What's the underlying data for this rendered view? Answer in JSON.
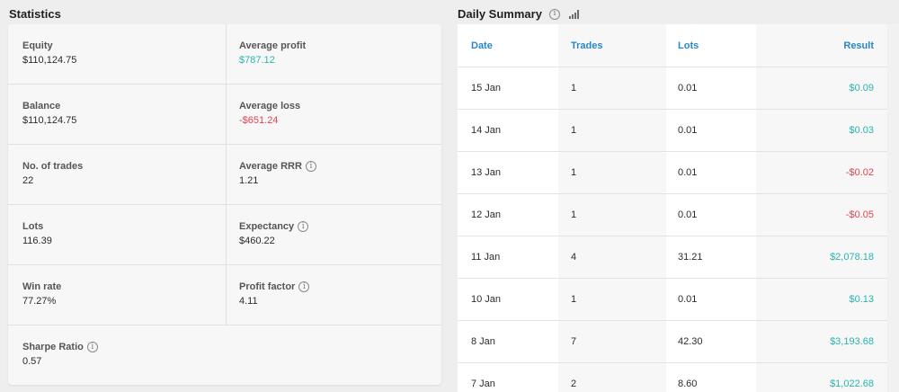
{
  "statistics": {
    "title": "Statistics",
    "left": [
      {
        "label": "Equity",
        "value": "$110,124.75",
        "tone": ""
      },
      {
        "label": "Balance",
        "value": "$110,124.75",
        "tone": ""
      },
      {
        "label": "No. of trades",
        "value": "22",
        "tone": ""
      },
      {
        "label": "Lots",
        "value": "116.39",
        "tone": ""
      },
      {
        "label": "Win rate",
        "value": "77.27%",
        "tone": ""
      },
      {
        "label": "Sharpe Ratio",
        "value": "0.57",
        "tone": "",
        "info": true
      }
    ],
    "right": [
      {
        "label": "Average profit",
        "value": "$787.12",
        "tone": "green"
      },
      {
        "label": "Average loss",
        "value": "-$651.24",
        "tone": "red"
      },
      {
        "label": "Average RRR",
        "value": "1.21",
        "tone": "",
        "info": true
      },
      {
        "label": "Expectancy",
        "value": "$460.22",
        "tone": "",
        "info": true
      },
      {
        "label": "Profit factor",
        "value": "4.11",
        "tone": "",
        "info": true
      }
    ]
  },
  "daily_summary": {
    "title": "Daily Summary",
    "info_icon": "info-icon",
    "chart_icon": "bar-chart-icon",
    "columns": {
      "date": "Date",
      "trades": "Trades",
      "lots": "Lots",
      "result": "Result"
    },
    "rows": [
      {
        "date": "15 Jan",
        "trades": "1",
        "lots": "0.01",
        "result": "$0.09",
        "tone": "green"
      },
      {
        "date": "14 Jan",
        "trades": "1",
        "lots": "0.01",
        "result": "$0.03",
        "tone": "green"
      },
      {
        "date": "13 Jan",
        "trades": "1",
        "lots": "0.01",
        "result": "-$0.02",
        "tone": "red"
      },
      {
        "date": "12 Jan",
        "trades": "1",
        "lots": "0.01",
        "result": "-$0.05",
        "tone": "red"
      },
      {
        "date": "11 Jan",
        "trades": "4",
        "lots": "31.21",
        "result": "$2,078.18",
        "tone": "green"
      },
      {
        "date": "10 Jan",
        "trades": "1",
        "lots": "0.01",
        "result": "$0.13",
        "tone": "green"
      },
      {
        "date": "8 Jan",
        "trades": "7",
        "lots": "42.30",
        "result": "$3,193.68",
        "tone": "green"
      },
      {
        "date": "7 Jan",
        "trades": "2",
        "lots": "8.60",
        "result": "$1,022.68",
        "tone": "green"
      }
    ]
  },
  "colors": {
    "green": "#27b5ae",
    "red": "#e0444f",
    "header_blue": "#2a86c9"
  }
}
